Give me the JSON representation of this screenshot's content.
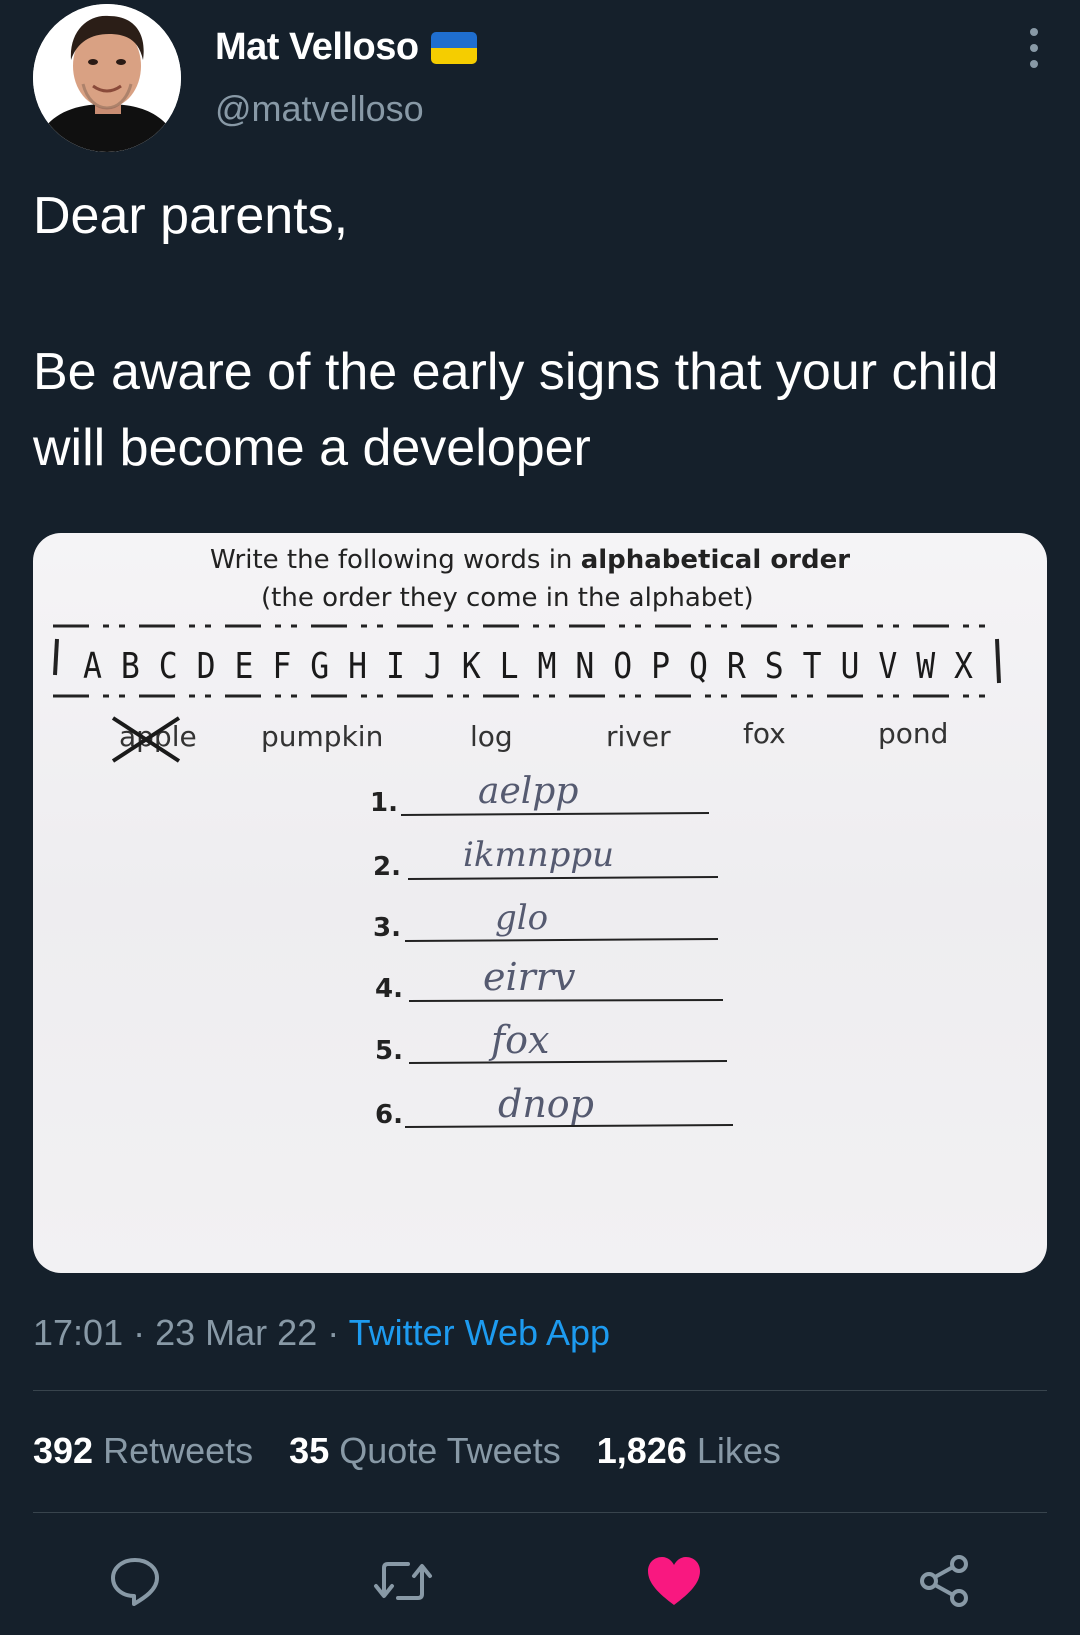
{
  "author": {
    "name": "Mat Velloso",
    "handle": "@matvelloso",
    "flag_colors": {
      "top": "#1f6ecf",
      "bottom": "#f5cd00"
    }
  },
  "tweet": {
    "greeting": "Dear parents,",
    "body": "Be aware of the early signs that your child will become a developer"
  },
  "worksheet": {
    "instruction_line1_plain": "Write the following words in ",
    "instruction_line1_bold": "alphabetical order",
    "instruction_line2": "(the order they come in the alphabet)",
    "alphabet": "A B C D E F G H I J K L M N O P Q R S T U V W X",
    "words": [
      "apple",
      "pumpkin",
      "log",
      "river",
      "fox",
      "pond"
    ],
    "answers": [
      {
        "number": "1.",
        "text": "aelpp"
      },
      {
        "number": "2.",
        "text": "ikmnppu"
      },
      {
        "number": "3.",
        "text": "glo"
      },
      {
        "number": "4.",
        "text": "eirrv"
      },
      {
        "number": "5.",
        "text": "fox"
      },
      {
        "number": "6.",
        "text": "dnop"
      }
    ]
  },
  "meta": {
    "time": "17:01",
    "date": "23 Mar 22",
    "separator": "·",
    "source": "Twitter Web App"
  },
  "stats": {
    "retweets_count": "392",
    "retweets_label": "Retweets",
    "quotes_count": "35",
    "quotes_label": "Quote Tweets",
    "likes_count": "1,826",
    "likes_label": "Likes"
  },
  "actions": {
    "reply_icon": "reply-icon",
    "retweet_icon": "retweet-icon",
    "like_icon": "heart-icon",
    "share_icon": "share-icon",
    "like_color": "#f91880"
  }
}
